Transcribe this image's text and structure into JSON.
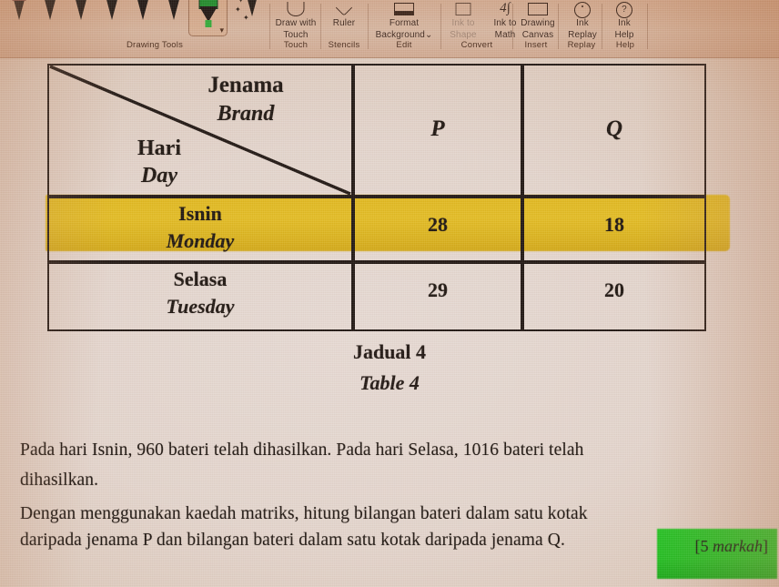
{
  "ribbon": {
    "groups": [
      {
        "label": "Drawing Tools"
      },
      {
        "label": "Touch"
      },
      {
        "label": "Stencils"
      },
      {
        "label": "Edit"
      },
      {
        "label": "Convert"
      },
      {
        "label": "Insert"
      },
      {
        "label": "Replay"
      },
      {
        "label": "Help"
      }
    ],
    "buttons": [
      {
        "line1": "Draw with",
        "line2": "Touch",
        "icon": "draw-with-touch-icon",
        "disabled": false
      },
      {
        "line1": "Ruler",
        "line2": "",
        "icon": "ruler-icon",
        "disabled": false
      },
      {
        "line1": "Format",
        "line2": "Background",
        "icon": "format-background-icon",
        "disabled": false,
        "caret": "⌄"
      },
      {
        "line1": "Ink to",
        "line2": "Shape",
        "icon": "ink-to-shape-icon",
        "disabled": true
      },
      {
        "line1": "Ink to",
        "line2": "Math",
        "icon": "ink-to-math-icon",
        "disabled": false
      },
      {
        "line1": "Drawing",
        "line2": "Canvas",
        "icon": "drawing-canvas-icon",
        "disabled": false
      },
      {
        "line1": "Ink",
        "line2": "Replay",
        "icon": "ink-replay-icon",
        "disabled": false
      },
      {
        "line1": "Ink",
        "line2": "Help",
        "icon": "ink-help-icon",
        "disabled": false
      }
    ],
    "pen_tray": {
      "pens": 6,
      "selected_tool": "green-highlighter",
      "selected_color": "#1f8a2a",
      "action_pen": "sparkle-pen"
    }
  },
  "worksheet": {
    "table": {
      "corner": {
        "col_header_ms": "Jenama",
        "col_header_en": "Brand",
        "row_header_ms": "Hari",
        "row_header_en": "Day"
      },
      "columns": [
        "P",
        "Q"
      ],
      "rows": [
        {
          "label_ms": "Isnin",
          "label_en": "Monday",
          "values": [
            "28",
            "18"
          ],
          "highlight": "#e0b81d"
        },
        {
          "label_ms": "Selasa",
          "label_en": "Tuesday",
          "values": [
            "29",
            "20"
          ],
          "highlight": null
        }
      ]
    },
    "caption": {
      "ms": "Jadual 4",
      "en": "Table 4"
    },
    "paragraphs": [
      "Pada hari Isnin, 960 bateri telah dihasilkan. Pada hari Selasa, 1016 bateri telah dihasilkan.",
      "Dengan menggunakan kaedah matriks, hitung bilangan bateri dalam satu kotak daripada jenama P dan bilangan bateri dalam satu kotak daripada jenama Q."
    ],
    "paragraph_lines": [
      "Pada hari Isnin, 960 bateri telah dihasilkan. Pada hari Selasa, 1016 bateri telah",
      "dihasilkan.",
      "Dengan menggunakan kaedah matriks, hitung bilangan bateri dalam satu kotak",
      "daripada jenama P dan bilangan bateri dalam satu kotak daripada jenama Q."
    ],
    "marks": {
      "text_prefix": "[5 ",
      "text_italic": "markah",
      "text_suffix": "]",
      "full": "[5 markah]",
      "highlight": "#21c221"
    }
  },
  "colors": {
    "paper": "#e3d5cd",
    "paper_edge": "#b87d58",
    "ink": "#1a120d",
    "yellow_highlight": "#e0b81d",
    "green_highlight": "#21c221",
    "highlighter_green": "#1f8a2a"
  }
}
